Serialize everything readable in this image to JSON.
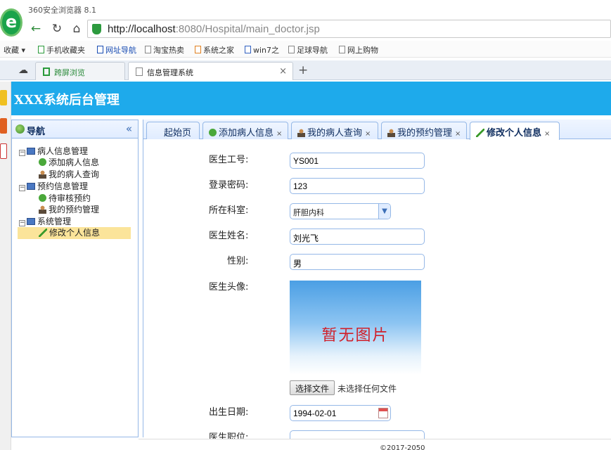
{
  "browser": {
    "name": "360安全浏览器 8.1",
    "url_host": "http://localhost",
    "url_rest": ":8080/Hospital/main_doctor.jsp",
    "bookmarks": [
      {
        "label": "收藏"
      },
      {
        "label": "手机收藏夹"
      },
      {
        "label": "网址导航"
      },
      {
        "label": "淘宝热卖"
      },
      {
        "label": "系统之家"
      },
      {
        "label": "win7之"
      },
      {
        "label": "足球导航"
      },
      {
        "label": "网上购物"
      }
    ],
    "tabs": [
      {
        "label": "跨屏浏览"
      },
      {
        "label": "信息管理系统"
      }
    ],
    "close_glyph": "×",
    "new_tab_glyph": "+"
  },
  "app": {
    "title": "XXX系统后台管理"
  },
  "sidebar": {
    "title": "导航",
    "collapse_glyph": "«",
    "groups": [
      {
        "label": "病人信息管理",
        "items": [
          {
            "label": "添加病人信息"
          },
          {
            "label": "我的病人查询"
          }
        ]
      },
      {
        "label": "预约信息管理",
        "items": [
          {
            "label": "待审核预约"
          },
          {
            "label": "我的预约管理"
          }
        ]
      },
      {
        "label": "系统管理",
        "items": [
          {
            "label": "修改个人信息"
          }
        ]
      }
    ]
  },
  "content_tabs": [
    {
      "label": "起始页"
    },
    {
      "label": "添加病人信息"
    },
    {
      "label": "我的病人查询"
    },
    {
      "label": "我的预约管理"
    },
    {
      "label": "修改个人信息"
    }
  ],
  "form": {
    "doctor_id": {
      "label": "医生工号:",
      "value": "YS001"
    },
    "password": {
      "label": "登录密码:",
      "value": "123"
    },
    "department": {
      "label": "所在科室:",
      "value": "肝胆内科"
    },
    "name": {
      "label": "医生姓名:",
      "value": "刘光飞"
    },
    "gender": {
      "label": "性别:",
      "value": "男"
    },
    "avatar": {
      "label": "医生头像:",
      "placeholder_text": "暂无图片"
    },
    "file": {
      "button": "选择文件",
      "status": "未选择任何文件"
    },
    "birth": {
      "label": "出生日期:",
      "value": "1994-02-01"
    },
    "title": {
      "label": "医生职位:"
    }
  },
  "footer": {
    "text": "©2017-2050"
  }
}
